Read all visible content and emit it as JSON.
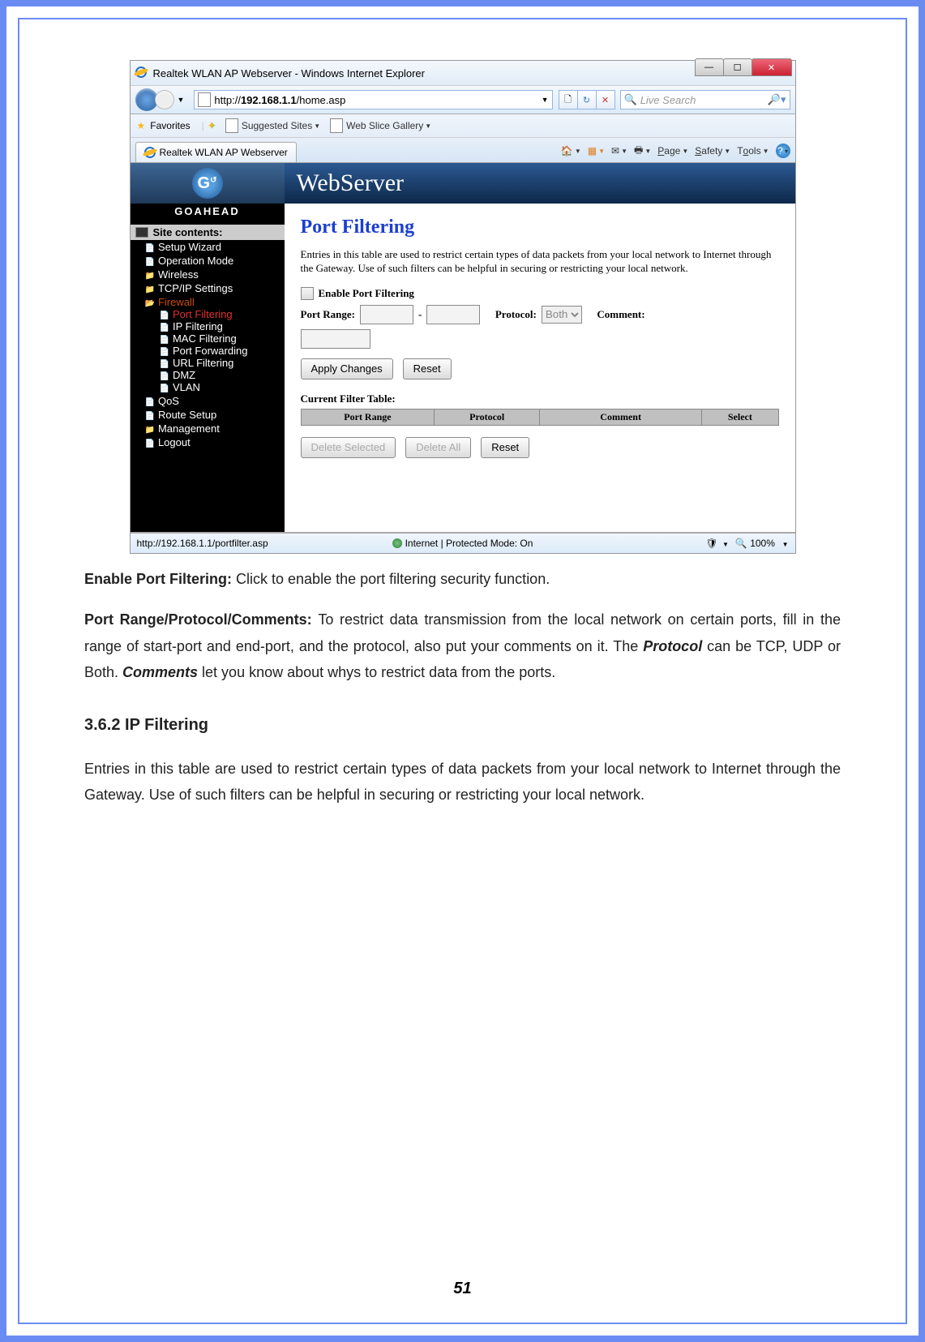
{
  "browser": {
    "title": "Realtek WLAN AP Webserver - Windows Internet Explorer",
    "url_prefix": "http://",
    "url_host": "192.168.1.1",
    "url_path": "/home.asp",
    "search_placeholder": "Live Search",
    "fav_label": "Favorites",
    "suggested": "Suggested Sites",
    "webslice": "Web Slice Gallery",
    "tab_label": "Realtek WLAN AP Webserver",
    "menu_page": "Page",
    "menu_safety": "Safety",
    "menu_tools": "Tools",
    "status_url": "http://192.168.1.1/portfilter.asp",
    "status_mode": "Internet | Protected Mode: On",
    "zoom": "100%"
  },
  "sidebar": {
    "brand": "GOAHEAD",
    "header": "Site contents:",
    "items": {
      "setup": "Setup Wizard",
      "opmode": "Operation Mode",
      "wireless": "Wireless",
      "tcpip": "TCP/IP Settings",
      "firewall": "Firewall",
      "portfilter": "Port Filtering",
      "ipfilter": "IP Filtering",
      "macfilter": "MAC Filtering",
      "portfwd": "Port Forwarding",
      "urlfilter": "URL Filtering",
      "dmz": "DMZ",
      "vlan": "VLAN",
      "qos": "QoS",
      "route": "Route Setup",
      "mgmt": "Management",
      "logout": "Logout"
    }
  },
  "page": {
    "banner": "WebServer",
    "title": "Port Filtering",
    "desc": "Entries in this table are used to restrict certain types of data packets from your local network to Internet through the Gateway. Use of such filters can be helpful in securing or restricting your local network.",
    "enable_label": "Enable Port Filtering",
    "range_label": "Port Range:",
    "proto_label": "Protocol:",
    "proto_value": "Both",
    "comment_label": "Comment:",
    "apply": "Apply Changes",
    "reset1": "Reset",
    "table_title": "Current Filter Table:",
    "th1": "Port Range",
    "th2": "Protocol",
    "th3": "Comment",
    "th4": "Select",
    "delsel": "Delete Selected",
    "delall": "Delete All",
    "reset2": "Reset"
  },
  "doc": {
    "l1b": "Enable Port Filtering: ",
    "l1": "Click to enable the port filtering security function.",
    "l2b": "Port Range/Protocol/Comments: ",
    "l2a": "To restrict data transmission from the local network on certain ports, fill in the range of start-port and end-port, and the protocol, also put your comments on it. The ",
    "l2p": "Protocol",
    "l2c": " can be TCP, UDP or Both. ",
    "l2cm": "Comments",
    "l2d": " let you know about whys to restrict data from the ports.",
    "sec": "3.6.2 IP Filtering",
    "sectxt": "Entries in this table are used to restrict certain types of data packets from your local network to Internet through the Gateway. Use of such filters can be helpful in securing or restricting your local network.",
    "pagenum": "51"
  }
}
